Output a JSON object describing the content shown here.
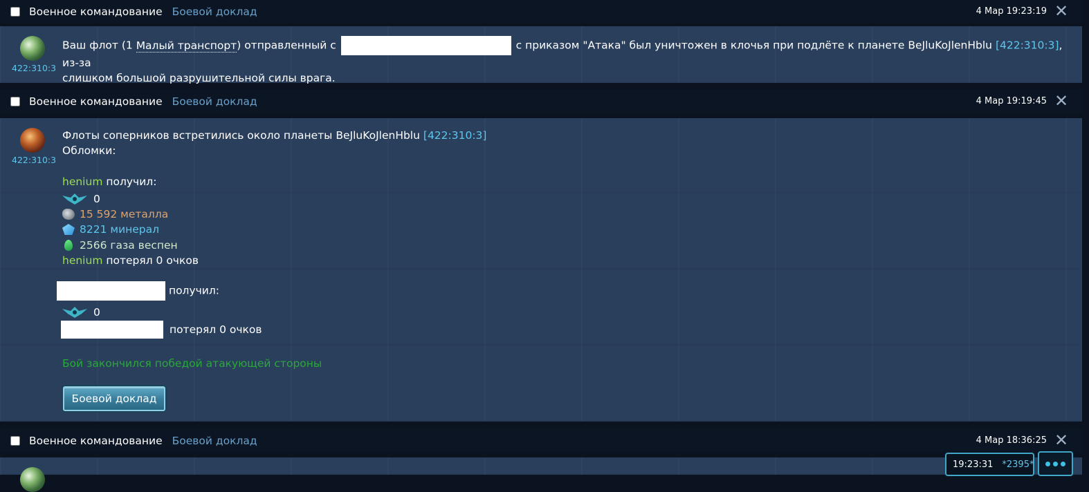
{
  "messages": [
    {
      "sender": "Военное командование",
      "subject": "Боевой доклад",
      "date": "4 Мар 19:23:19",
      "avatar_coord": "422:310:3",
      "text": {
        "part1": "Ваш флот (1 ",
        "ship": "Малый транспорт",
        "part2": ") отправленный с",
        "part3": "с приказом \"Атака\" был уничтожен в клочья при подлёте к планете BeJluKoJlenHblu",
        "coord": "[422:310:3]",
        "part4": ", из-за",
        "line2": "слишком большой разрушительной силы врага."
      }
    },
    {
      "sender": "Военное командование",
      "subject": "Боевой доклад",
      "date": "4 Мар 19:19:45",
      "avatar_coord": "422:310:3",
      "intro": "Флоты соперников встретились около планеты BeJluKoJlenHblu",
      "intro_coord": "[422:310:3]",
      "debris_label": "Обломки:",
      "attacker": {
        "name": "henium",
        "received_label": "получил:",
        "rank_value": "0",
        "metal": "15 592 металла",
        "crystal": "8221 минерал",
        "gas": "2566 газа веспен",
        "lost": "потерял 0 очков"
      },
      "defender": {
        "received_label": "получил:",
        "rank_value": "0",
        "lost": "потерял 0 очков"
      },
      "result": "Бой закончился победой атакующей стороны",
      "button": "Боевой доклад"
    },
    {
      "sender": "Военное командование",
      "subject": "Боевой доклад",
      "date": "4 Мар 18:36:25"
    }
  ],
  "status": {
    "time": "19:23:31",
    "count": "*2395*"
  },
  "icons": {
    "close": "close-icon",
    "metal": "metal-icon",
    "crystal": "crystal-icon",
    "gas": "gas-icon",
    "rank": "rank-icon",
    "menu": "more-menu-icon"
  }
}
